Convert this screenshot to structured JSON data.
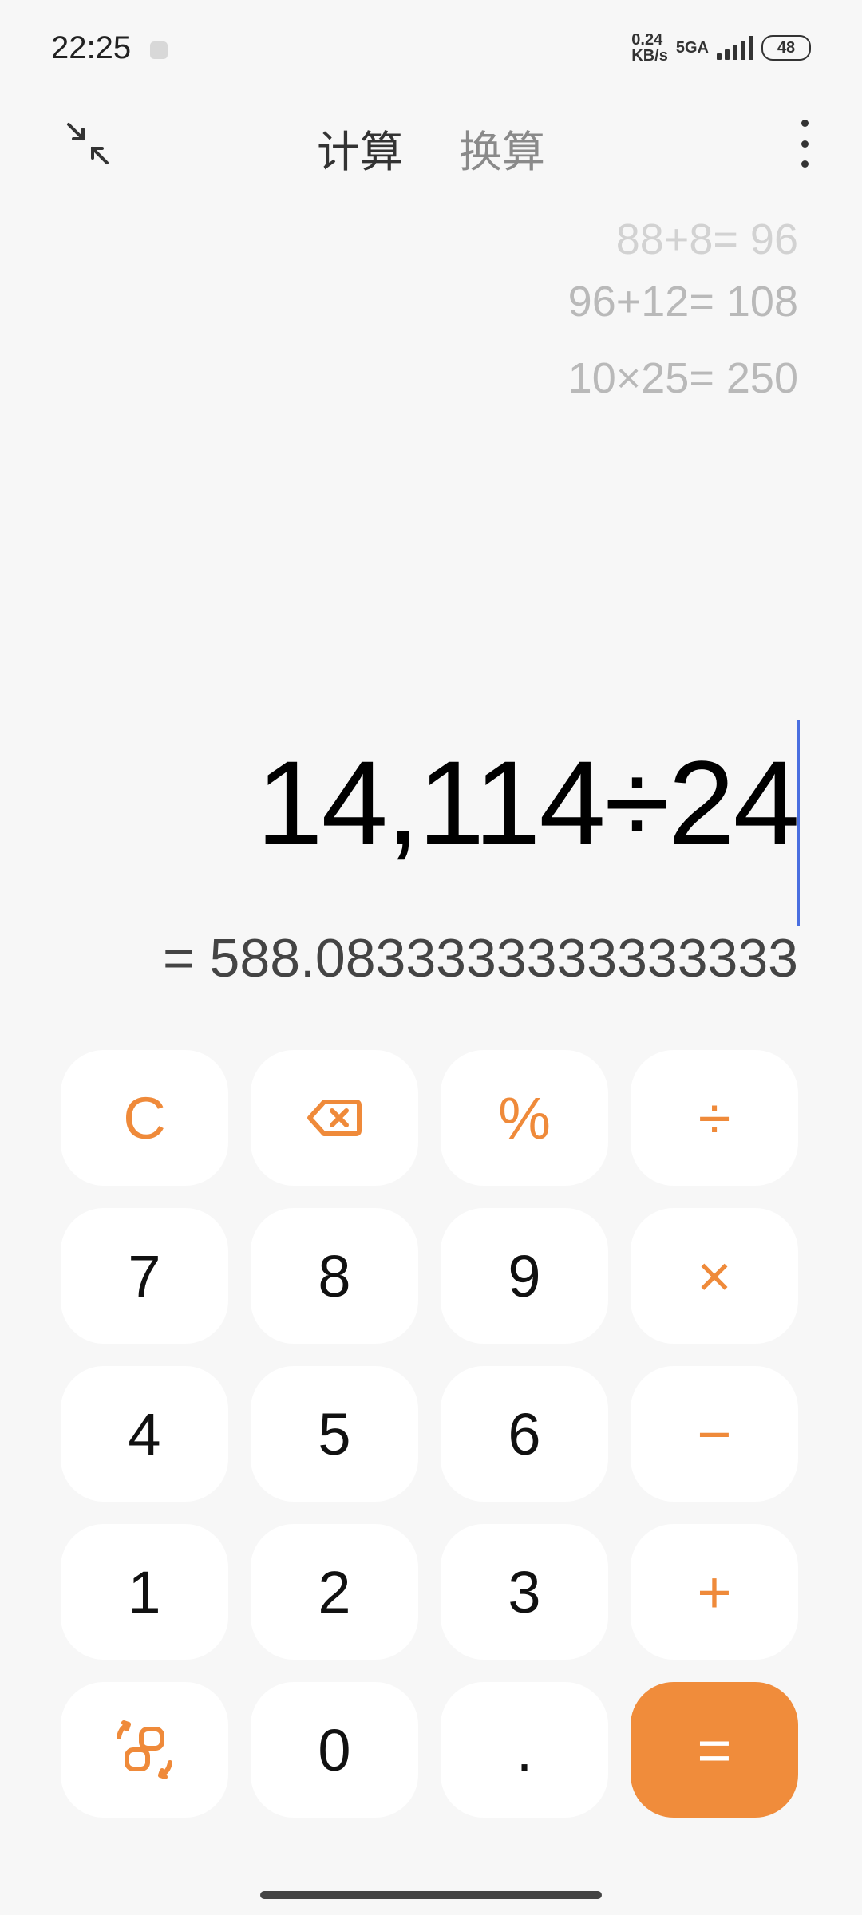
{
  "status_bar": {
    "time": "22:25",
    "net_speed_value": "0.24",
    "net_speed_unit": "KB/s",
    "network": "5GA",
    "battery": "48"
  },
  "top_bar": {
    "tabs": [
      {
        "label": "计算",
        "active": true
      },
      {
        "label": "换算",
        "active": false
      }
    ]
  },
  "history": [
    {
      "expression": "88+8=",
      "result": "96"
    },
    {
      "expression": "96+12=",
      "result": "108"
    },
    {
      "expression": "10×25=",
      "result": "250"
    }
  ],
  "display": {
    "expression": "14,114÷24",
    "result": "= 588.0833333333333333"
  },
  "keypad": {
    "clear": "C",
    "percent": "%",
    "divide": "÷",
    "seven": "7",
    "eight": "8",
    "nine": "9",
    "multiply": "×",
    "four": "4",
    "five": "5",
    "six": "6",
    "minus": "−",
    "one": "1",
    "two": "2",
    "three": "3",
    "plus": "+",
    "zero": "0",
    "decimal": ".",
    "equals": "="
  },
  "colors": {
    "accent": "#ef8a3a",
    "equals_bg": "#f08c3b",
    "cursor": "#4a6fe0",
    "background": "#f7f7f7"
  }
}
